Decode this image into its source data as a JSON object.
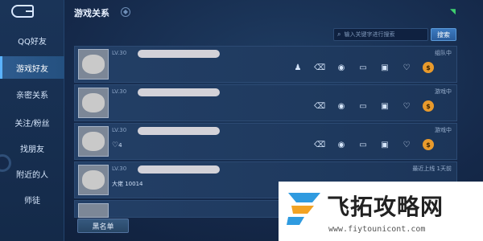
{
  "header": {
    "title": "游戏关系"
  },
  "sidebar": {
    "items": [
      {
        "label": "QQ好友"
      },
      {
        "label": "游戏好友"
      },
      {
        "label": "亲密关系"
      },
      {
        "label": "关注/粉丝"
      },
      {
        "label": "找朋友"
      },
      {
        "label": "附近的人"
      },
      {
        "label": "师徒"
      }
    ]
  },
  "search": {
    "placeholder": "输入关键字进行搜索",
    "button_label": "搜索"
  },
  "friends": [
    {
      "level": "LV.30",
      "status": "组队中",
      "sub": ""
    },
    {
      "level": "LV.30",
      "status": "游戏中",
      "sub": ""
    },
    {
      "level": "LV.30",
      "status": "游戏中",
      "sub": "4"
    },
    {
      "level": "LV.30",
      "status": "最近上线 1天前",
      "sub": "大佬 10014"
    }
  ],
  "footer": {
    "blacklist_label": "黑名单"
  },
  "watermark": {
    "text": "飞拓攻略网",
    "url": "www.fiytounicont.com"
  },
  "colors": {
    "accent": "#3c7ac0",
    "gold_badge": "#e89a2c",
    "online_wifi": "#3fd16f"
  }
}
